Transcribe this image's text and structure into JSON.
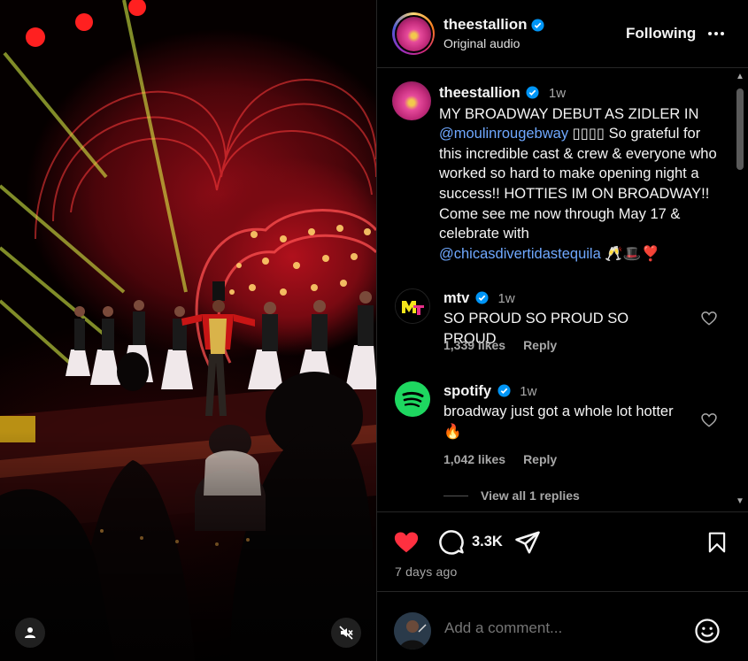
{
  "post": {
    "author": "theestallion",
    "audio": "Original audio",
    "follow_label": "Following",
    "caption": {
      "time": "1w",
      "text_1": "MY BROADWAY DEBUT AS ZIDLER IN",
      "mention_1": "@moulinrougebway",
      "text_2": " ▯▯▯▯ So grateful for this incredible cast & crew & everyone who worked so hard to make opening night a success!! HOTTIES IM ON BROADWAY!! Come see me now through May 17 & celebrate with",
      "mention_2": "@chicasdivertidastequila",
      "emoji": " 🥂🎩❣️"
    }
  },
  "comments": [
    {
      "user": "mtv",
      "time": "1w",
      "text": "SO PROUD SO PROUD SO PROUD",
      "likes": "1,339 likes",
      "reply": "Reply"
    },
    {
      "user": "spotify",
      "time": "1w",
      "text": "broadway just got a whole lot hotter 🔥",
      "likes": "1,042 likes",
      "reply": "Reply"
    }
  ],
  "view_replies": "View all 1 replies",
  "actions": {
    "comment_count": "3.3K",
    "date": "7 days ago",
    "liked": true
  },
  "add_comment": {
    "placeholder": "Add a comment..."
  },
  "colors": {
    "like_red": "#ff3040",
    "verified_blue": "#0095f6",
    "link_blue": "#6fa8ff",
    "spotify_green": "#1ed760"
  },
  "icons": [
    "user-tag-icon",
    "mute-icon",
    "verified-icon",
    "more-icon",
    "heart-icon",
    "comment-icon",
    "share-icon",
    "bookmark-icon",
    "emoji-icon"
  ]
}
